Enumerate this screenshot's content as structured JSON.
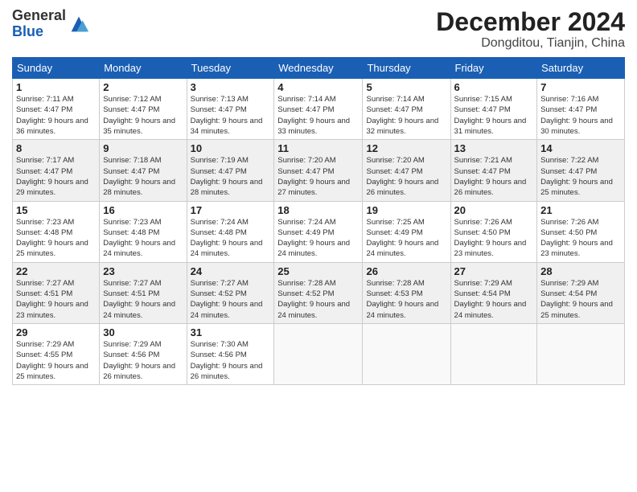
{
  "header": {
    "logo_line1": "General",
    "logo_line2": "Blue",
    "month": "December 2024",
    "location": "Dongditou, Tianjin, China"
  },
  "weekdays": [
    "Sunday",
    "Monday",
    "Tuesday",
    "Wednesday",
    "Thursday",
    "Friday",
    "Saturday"
  ],
  "weeks": [
    [
      {
        "day": "1",
        "sunrise": "Sunrise: 7:11 AM",
        "sunset": "Sunset: 4:47 PM",
        "daylight": "Daylight: 9 hours and 36 minutes."
      },
      {
        "day": "2",
        "sunrise": "Sunrise: 7:12 AM",
        "sunset": "Sunset: 4:47 PM",
        "daylight": "Daylight: 9 hours and 35 minutes."
      },
      {
        "day": "3",
        "sunrise": "Sunrise: 7:13 AM",
        "sunset": "Sunset: 4:47 PM",
        "daylight": "Daylight: 9 hours and 34 minutes."
      },
      {
        "day": "4",
        "sunrise": "Sunrise: 7:14 AM",
        "sunset": "Sunset: 4:47 PM",
        "daylight": "Daylight: 9 hours and 33 minutes."
      },
      {
        "day": "5",
        "sunrise": "Sunrise: 7:14 AM",
        "sunset": "Sunset: 4:47 PM",
        "daylight": "Daylight: 9 hours and 32 minutes."
      },
      {
        "day": "6",
        "sunrise": "Sunrise: 7:15 AM",
        "sunset": "Sunset: 4:47 PM",
        "daylight": "Daylight: 9 hours and 31 minutes."
      },
      {
        "day": "7",
        "sunrise": "Sunrise: 7:16 AM",
        "sunset": "Sunset: 4:47 PM",
        "daylight": "Daylight: 9 hours and 30 minutes."
      }
    ],
    [
      {
        "day": "8",
        "sunrise": "Sunrise: 7:17 AM",
        "sunset": "Sunset: 4:47 PM",
        "daylight": "Daylight: 9 hours and 29 minutes."
      },
      {
        "day": "9",
        "sunrise": "Sunrise: 7:18 AM",
        "sunset": "Sunset: 4:47 PM",
        "daylight": "Daylight: 9 hours and 28 minutes."
      },
      {
        "day": "10",
        "sunrise": "Sunrise: 7:19 AM",
        "sunset": "Sunset: 4:47 PM",
        "daylight": "Daylight: 9 hours and 28 minutes."
      },
      {
        "day": "11",
        "sunrise": "Sunrise: 7:20 AM",
        "sunset": "Sunset: 4:47 PM",
        "daylight": "Daylight: 9 hours and 27 minutes."
      },
      {
        "day": "12",
        "sunrise": "Sunrise: 7:20 AM",
        "sunset": "Sunset: 4:47 PM",
        "daylight": "Daylight: 9 hours and 26 minutes."
      },
      {
        "day": "13",
        "sunrise": "Sunrise: 7:21 AM",
        "sunset": "Sunset: 4:47 PM",
        "daylight": "Daylight: 9 hours and 26 minutes."
      },
      {
        "day": "14",
        "sunrise": "Sunrise: 7:22 AM",
        "sunset": "Sunset: 4:47 PM",
        "daylight": "Daylight: 9 hours and 25 minutes."
      }
    ],
    [
      {
        "day": "15",
        "sunrise": "Sunrise: 7:23 AM",
        "sunset": "Sunset: 4:48 PM",
        "daylight": "Daylight: 9 hours and 25 minutes."
      },
      {
        "day": "16",
        "sunrise": "Sunrise: 7:23 AM",
        "sunset": "Sunset: 4:48 PM",
        "daylight": "Daylight: 9 hours and 24 minutes."
      },
      {
        "day": "17",
        "sunrise": "Sunrise: 7:24 AM",
        "sunset": "Sunset: 4:48 PM",
        "daylight": "Daylight: 9 hours and 24 minutes."
      },
      {
        "day": "18",
        "sunrise": "Sunrise: 7:24 AM",
        "sunset": "Sunset: 4:49 PM",
        "daylight": "Daylight: 9 hours and 24 minutes."
      },
      {
        "day": "19",
        "sunrise": "Sunrise: 7:25 AM",
        "sunset": "Sunset: 4:49 PM",
        "daylight": "Daylight: 9 hours and 24 minutes."
      },
      {
        "day": "20",
        "sunrise": "Sunrise: 7:26 AM",
        "sunset": "Sunset: 4:50 PM",
        "daylight": "Daylight: 9 hours and 23 minutes."
      },
      {
        "day": "21",
        "sunrise": "Sunrise: 7:26 AM",
        "sunset": "Sunset: 4:50 PM",
        "daylight": "Daylight: 9 hours and 23 minutes."
      }
    ],
    [
      {
        "day": "22",
        "sunrise": "Sunrise: 7:27 AM",
        "sunset": "Sunset: 4:51 PM",
        "daylight": "Daylight: 9 hours and 23 minutes."
      },
      {
        "day": "23",
        "sunrise": "Sunrise: 7:27 AM",
        "sunset": "Sunset: 4:51 PM",
        "daylight": "Daylight: 9 hours and 24 minutes."
      },
      {
        "day": "24",
        "sunrise": "Sunrise: 7:27 AM",
        "sunset": "Sunset: 4:52 PM",
        "daylight": "Daylight: 9 hours and 24 minutes."
      },
      {
        "day": "25",
        "sunrise": "Sunrise: 7:28 AM",
        "sunset": "Sunset: 4:52 PM",
        "daylight": "Daylight: 9 hours and 24 minutes."
      },
      {
        "day": "26",
        "sunrise": "Sunrise: 7:28 AM",
        "sunset": "Sunset: 4:53 PM",
        "daylight": "Daylight: 9 hours and 24 minutes."
      },
      {
        "day": "27",
        "sunrise": "Sunrise: 7:29 AM",
        "sunset": "Sunset: 4:54 PM",
        "daylight": "Daylight: 9 hours and 24 minutes."
      },
      {
        "day": "28",
        "sunrise": "Sunrise: 7:29 AM",
        "sunset": "Sunset: 4:54 PM",
        "daylight": "Daylight: 9 hours and 25 minutes."
      }
    ],
    [
      {
        "day": "29",
        "sunrise": "Sunrise: 7:29 AM",
        "sunset": "Sunset: 4:55 PM",
        "daylight": "Daylight: 9 hours and 25 minutes."
      },
      {
        "day": "30",
        "sunrise": "Sunrise: 7:29 AM",
        "sunset": "Sunset: 4:56 PM",
        "daylight": "Daylight: 9 hours and 26 minutes."
      },
      {
        "day": "31",
        "sunrise": "Sunrise: 7:30 AM",
        "sunset": "Sunset: 4:56 PM",
        "daylight": "Daylight: 9 hours and 26 minutes."
      },
      null,
      null,
      null,
      null
    ]
  ]
}
